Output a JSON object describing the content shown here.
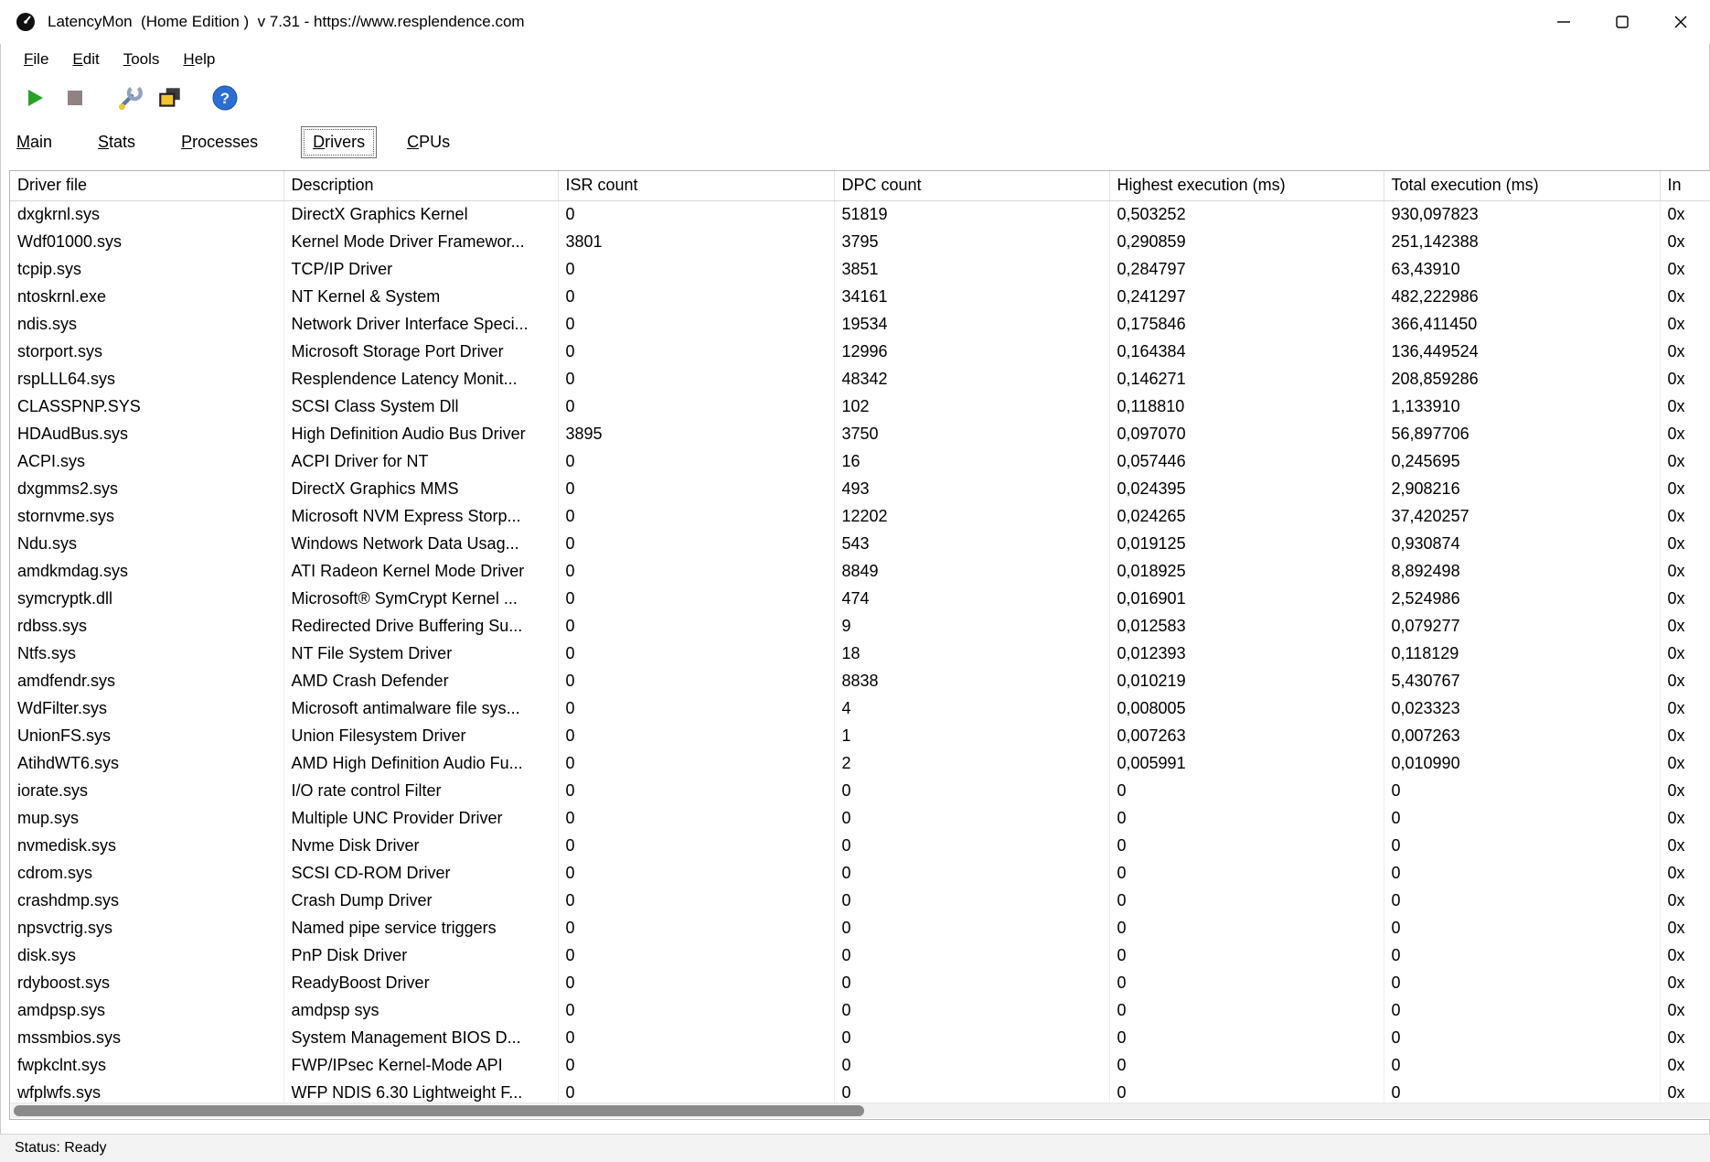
{
  "window": {
    "title": "LatencyMon  (Home Edition )  v 7.31 - https://www.resplendence.com"
  },
  "icons": {
    "help_glyph": "?"
  },
  "menu": {
    "items": [
      {
        "accel": "F",
        "rest": "ile"
      },
      {
        "accel": "E",
        "rest": "dit"
      },
      {
        "accel": "T",
        "rest": "ools"
      },
      {
        "accel": "H",
        "rest": "elp"
      }
    ]
  },
  "toolbar": {
    "buttons": [
      "start-monitoring",
      "stop-monitoring",
      "options",
      "report",
      "help"
    ]
  },
  "tabs": {
    "items": [
      {
        "accel": "M",
        "rest": "ain"
      },
      {
        "accel": "S",
        "rest": "tats"
      },
      {
        "accel": "P",
        "rest": "rocesses"
      },
      {
        "accel": "D",
        "rest": "rivers"
      },
      {
        "accel": "C",
        "rest": "PUs"
      }
    ]
  },
  "table": {
    "columns": [
      "Driver file",
      "Description",
      "ISR count",
      "DPC count",
      "Highest execution (ms)",
      "Total execution (ms)",
      "In"
    ],
    "rows": [
      [
        "dxgkrnl.sys",
        "DirectX Graphics Kernel",
        "0",
        "51819",
        "0,503252",
        "930,097823",
        "0x"
      ],
      [
        "Wdf01000.sys",
        "Kernel Mode Driver Framewor...",
        "3801",
        "3795",
        "0,290859",
        "251,142388",
        "0x"
      ],
      [
        "tcpip.sys",
        "TCP/IP Driver",
        "0",
        "3851",
        "0,284797",
        "63,43910",
        "0x"
      ],
      [
        "ntoskrnl.exe",
        "NT Kernel & System",
        "0",
        "34161",
        "0,241297",
        "482,222986",
        "0x"
      ],
      [
        "ndis.sys",
        "Network Driver Interface Speci...",
        "0",
        "19534",
        "0,175846",
        "366,411450",
        "0x"
      ],
      [
        "storport.sys",
        "Microsoft Storage Port Driver",
        "0",
        "12996",
        "0,164384",
        "136,449524",
        "0x"
      ],
      [
        "rspLLL64.sys",
        "Resplendence Latency Monit...",
        "0",
        "48342",
        "0,146271",
        "208,859286",
        "0x"
      ],
      [
        "CLASSPNP.SYS",
        "SCSI Class System Dll",
        "0",
        "102",
        "0,118810",
        "1,133910",
        "0x"
      ],
      [
        "HDAudBus.sys",
        "High Definition Audio Bus Driver",
        "3895",
        "3750",
        "0,097070",
        "56,897706",
        "0x"
      ],
      [
        "ACPI.sys",
        "ACPI Driver for NT",
        "0",
        "16",
        "0,057446",
        "0,245695",
        "0x"
      ],
      [
        "dxgmms2.sys",
        "DirectX Graphics MMS",
        "0",
        "493",
        "0,024395",
        "2,908216",
        "0x"
      ],
      [
        "stornvme.sys",
        "Microsoft NVM Express Storp...",
        "0",
        "12202",
        "0,024265",
        "37,420257",
        "0x"
      ],
      [
        "Ndu.sys",
        "Windows Network Data Usag...",
        "0",
        "543",
        "0,019125",
        "0,930874",
        "0x"
      ],
      [
        "amdkmdag.sys",
        "ATI Radeon Kernel Mode Driver",
        "0",
        "8849",
        "0,018925",
        "8,892498",
        "0x"
      ],
      [
        "symcryptk.dll",
        "Microsoft® SymCrypt Kernel ...",
        "0",
        "474",
        "0,016901",
        "2,524986",
        "0x"
      ],
      [
        "rdbss.sys",
        "Redirected Drive Buffering Su...",
        "0",
        "9",
        "0,012583",
        "0,079277",
        "0x"
      ],
      [
        "Ntfs.sys",
        "NT File System Driver",
        "0",
        "18",
        "0,012393",
        "0,118129",
        "0x"
      ],
      [
        "amdfendr.sys",
        "AMD Crash Defender",
        "0",
        "8838",
        "0,010219",
        "5,430767",
        "0x"
      ],
      [
        "WdFilter.sys",
        "Microsoft antimalware file sys...",
        "0",
        "4",
        "0,008005",
        "0,023323",
        "0x"
      ],
      [
        "UnionFS.sys",
        "Union Filesystem Driver",
        "0",
        "1",
        "0,007263",
        "0,007263",
        "0x"
      ],
      [
        "AtihdWT6.sys",
        "AMD High Definition Audio Fu...",
        "0",
        "2",
        "0,005991",
        "0,010990",
        "0x"
      ],
      [
        "iorate.sys",
        "I/O rate control Filter",
        "0",
        "0",
        "0",
        "0",
        "0x"
      ],
      [
        "mup.sys",
        "Multiple UNC Provider Driver",
        "0",
        "0",
        "0",
        "0",
        "0x"
      ],
      [
        "nvmedisk.sys",
        "Nvme Disk Driver",
        "0",
        "0",
        "0",
        "0",
        "0x"
      ],
      [
        "cdrom.sys",
        "SCSI CD-ROM Driver",
        "0",
        "0",
        "0",
        "0",
        "0x"
      ],
      [
        "crashdmp.sys",
        "Crash Dump Driver",
        "0",
        "0",
        "0",
        "0",
        "0x"
      ],
      [
        "npsvctrig.sys",
        "Named pipe service triggers",
        "0",
        "0",
        "0",
        "0",
        "0x"
      ],
      [
        "disk.sys",
        "PnP Disk Driver",
        "0",
        "0",
        "0",
        "0",
        "0x"
      ],
      [
        "rdyboost.sys",
        "ReadyBoost Driver",
        "0",
        "0",
        "0",
        "0",
        "0x"
      ],
      [
        "amdpsp.sys",
        "amdpsp sys",
        "0",
        "0",
        "0",
        "0",
        "0x"
      ],
      [
        "mssmbios.sys",
        "System Management BIOS D...",
        "0",
        "0",
        "0",
        "0",
        "0x"
      ],
      [
        "fwpkclnt.sys",
        "FWP/IPsec Kernel-Mode API",
        "0",
        "0",
        "0",
        "0",
        "0x"
      ],
      [
        "wfplwfs.sys",
        "WFP NDIS 6.30 Lightweight F...",
        "0",
        "0",
        "0",
        "0",
        "0x"
      ]
    ]
  },
  "statusbar": {
    "text": "Status: Ready"
  }
}
